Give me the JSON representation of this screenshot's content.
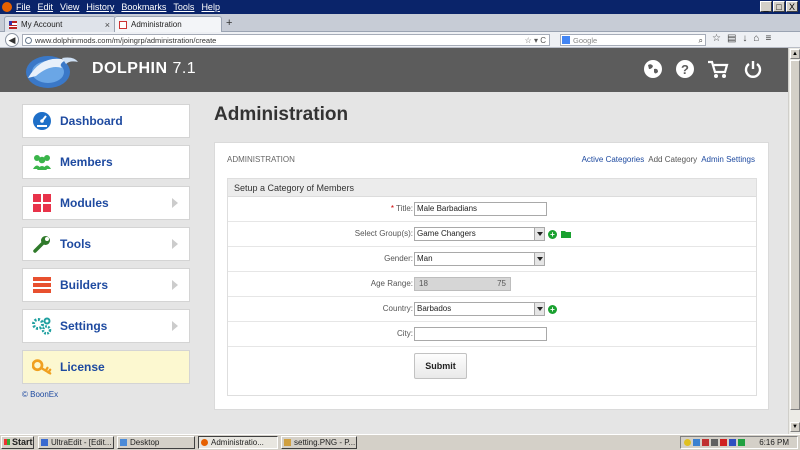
{
  "browser": {
    "menu": [
      "File",
      "Edit",
      "View",
      "History",
      "Bookmarks",
      "Tools",
      "Help"
    ],
    "tabs": [
      {
        "title": "My Account",
        "active": false
      },
      {
        "title": "Administration",
        "active": true
      }
    ],
    "new_tab": "+",
    "url_host": "www.dolphinmods.com",
    "url_path": "/m/joingrp/administration/create",
    "search_placeholder": "Google",
    "window_controls": [
      "_",
      "□",
      "X"
    ]
  },
  "header": {
    "brand": "DOLPHIN",
    "version": "7.1",
    "icons": [
      "globe-icon",
      "help-icon",
      "cart-icon",
      "power-icon"
    ]
  },
  "sidebar": {
    "items": [
      {
        "label": "Dashboard",
        "icon": "dashboard-icon",
        "color": "#1e6fc8",
        "has_arrow": false,
        "active": false
      },
      {
        "label": "Members",
        "icon": "members-icon",
        "color": "#3ab54a",
        "has_arrow": false,
        "active": false
      },
      {
        "label": "Modules",
        "icon": "modules-icon",
        "color": "#e8334a",
        "has_arrow": true,
        "active": false
      },
      {
        "label": "Tools",
        "icon": "tools-icon",
        "color": "#2f7a2a",
        "has_arrow": true,
        "active": false
      },
      {
        "label": "Builders",
        "icon": "builders-icon",
        "color": "#e8502f",
        "has_arrow": true,
        "active": false
      },
      {
        "label": "Settings",
        "icon": "settings-icon",
        "color": "#20a0a0",
        "has_arrow": true,
        "active": false
      },
      {
        "label": "License",
        "icon": "key-icon",
        "color": "#f0a020",
        "has_arrow": false,
        "active": true
      }
    ],
    "copyright": "© BoonEx"
  },
  "main": {
    "title": "Administration",
    "panel_heading": "ADMINISTRATION",
    "links": [
      {
        "label": "Active Categories",
        "current": false
      },
      {
        "label": "Add Category",
        "current": true
      },
      {
        "label": "Admin Settings",
        "current": false
      }
    ],
    "form": {
      "title": "Setup a Category of Members",
      "title_field": {
        "label": "Title:",
        "required_mark": "*",
        "value": "Male Barbadians"
      },
      "group_field": {
        "label": "Select Group(s):",
        "value": "Game Changers"
      },
      "gender_field": {
        "label": "Gender:",
        "value": "Man"
      },
      "age_field": {
        "label": "Age Range:",
        "min": "18",
        "max": "75"
      },
      "country_field": {
        "label": "Country:",
        "value": "Barbados"
      },
      "city_field": {
        "label": "City:",
        "value": ""
      },
      "submit_label": "Submit"
    }
  },
  "taskbar": {
    "start": "Start",
    "buttons": [
      {
        "label": "UltraEdit - [Edit...",
        "pressed": false
      },
      {
        "label": "Desktop",
        "pressed": false
      },
      {
        "label": "Administratio...",
        "pressed": true
      },
      {
        "label": "setting.PNG - P...",
        "pressed": false
      }
    ],
    "clock": "6:16 PM"
  },
  "colors": {
    "header_bg": "#5c5c5c",
    "link": "#1e4aa0",
    "active_item_bg": "#fcf8d0",
    "add_green": "#1aa130"
  }
}
